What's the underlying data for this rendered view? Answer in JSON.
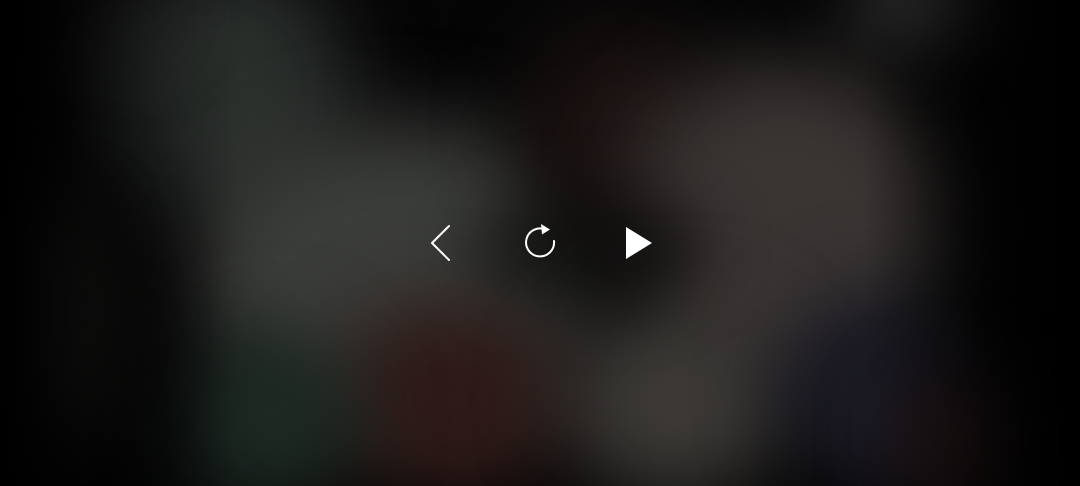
{
  "player": {
    "controls": [
      {
        "id": "previous",
        "icon": "chevron-left-icon"
      },
      {
        "id": "replay",
        "icon": "replay-icon"
      },
      {
        "id": "play",
        "icon": "play-icon"
      }
    ],
    "icon_color": "#ffffff"
  }
}
